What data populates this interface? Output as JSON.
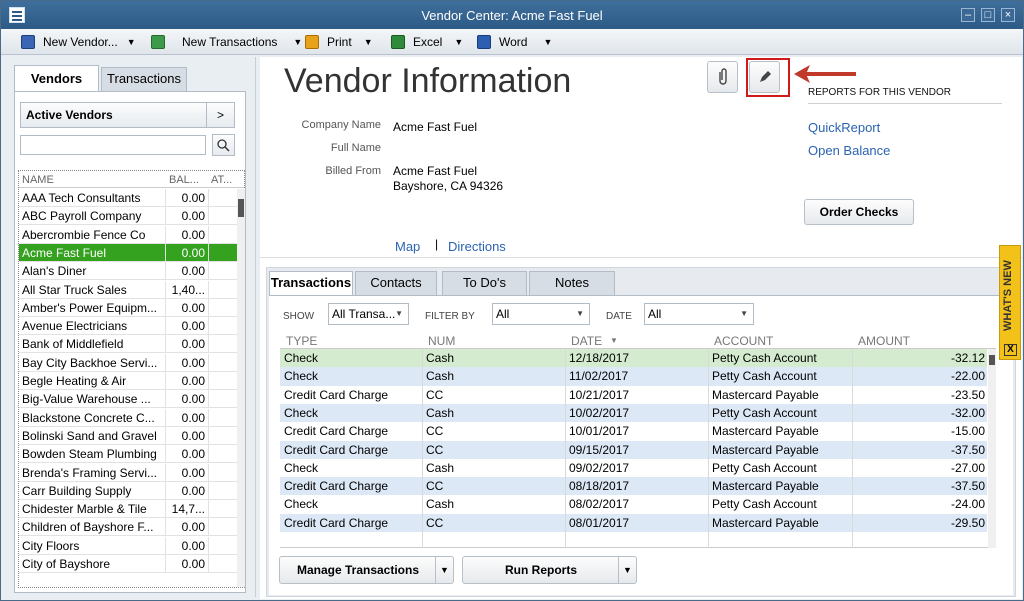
{
  "window": {
    "title": "Vendor Center: Acme Fast Fuel",
    "min": "–",
    "max": "□",
    "close": "×"
  },
  "toolbar": {
    "new_vendor": "New Vendor...",
    "new_transactions": "New Transactions",
    "print": "Print",
    "excel": "Excel",
    "word": "Word",
    "dropdown": "▼"
  },
  "left": {
    "tabs": {
      "vendors": "Vendors",
      "transactions": "Transactions"
    },
    "filter": {
      "label": "Active Vendors",
      "arrow": ">"
    },
    "columns": {
      "name": "NAME",
      "balance": "BAL...",
      "attach": "AT..."
    },
    "vendors": [
      {
        "name": "AAA Tech Consultants",
        "balance": "0.00"
      },
      {
        "name": "ABC Payroll Company",
        "balance": "0.00"
      },
      {
        "name": "Abercrombie Fence Co",
        "balance": "0.00"
      },
      {
        "name": "Acme Fast Fuel",
        "balance": "0.00",
        "selected": true
      },
      {
        "name": "Alan's Diner",
        "balance": "0.00"
      },
      {
        "name": "All Star Truck Sales",
        "balance": "1,40..."
      },
      {
        "name": "Amber's Power Equipm...",
        "balance": "0.00"
      },
      {
        "name": "Avenue Electricians",
        "balance": "0.00"
      },
      {
        "name": "Bank of Middlefield",
        "balance": "0.00"
      },
      {
        "name": "Bay City Backhoe Servi...",
        "balance": "0.00"
      },
      {
        "name": "Begle Heating & Air",
        "balance": "0.00"
      },
      {
        "name": "Big-Value Warehouse ...",
        "balance": "0.00"
      },
      {
        "name": "Blackstone Concrete C...",
        "balance": "0.00"
      },
      {
        "name": "Bolinski Sand and Gravel",
        "balance": "0.00"
      },
      {
        "name": "Bowden Steam Plumbing",
        "balance": "0.00"
      },
      {
        "name": "Brenda's Framing Servi...",
        "balance": "0.00"
      },
      {
        "name": "Carr Building Supply",
        "balance": "0.00"
      },
      {
        "name": "Chidester Marble & Tile",
        "balance": "14,7..."
      },
      {
        "name": "Children of Bayshore F...",
        "balance": "0.00"
      },
      {
        "name": "City Floors",
        "balance": "0.00"
      },
      {
        "name": "City of Bayshore",
        "balance": "0.00"
      }
    ]
  },
  "info": {
    "title": "Vendor Information",
    "labels": {
      "company_name": "Company Name",
      "full_name": "Full Name",
      "billed_from": "Billed From"
    },
    "company_name": "Acme Fast Fuel",
    "billed_from_line1": "Acme Fast Fuel",
    "billed_from_line2": "Bayshore, CA 94326",
    "map": "Map",
    "separator": "|",
    "directions": "Directions",
    "reports_header": "REPORTS FOR THIS VENDOR",
    "quick_report": "QuickReport",
    "open_balance": "Open Balance",
    "order_checks": "Order Checks"
  },
  "tx": {
    "tabs": {
      "transactions": "Transactions",
      "contacts": "Contacts",
      "todos": "To Do's",
      "notes": "Notes"
    },
    "filters": {
      "show_label": "SHOW",
      "show_value": "All Transa...",
      "filter_label": "FILTER BY",
      "filter_value": "All",
      "date_label": "DATE",
      "date_value": "All"
    },
    "columns": {
      "type": "TYPE",
      "num": "NUM",
      "date": "DATE",
      "account": "ACCOUNT",
      "amount": "AMOUNT"
    },
    "rows": [
      {
        "type": "Check",
        "num": "Cash",
        "date": "12/18/2017",
        "account": "Petty Cash Account",
        "amount": "-32.12"
      },
      {
        "type": "Check",
        "num": "Cash",
        "date": "11/02/2017",
        "account": "Petty Cash Account",
        "amount": "-22.00"
      },
      {
        "type": "Credit Card Charge",
        "num": "CC",
        "date": "10/21/2017",
        "account": "Mastercard Payable",
        "amount": "-23.50"
      },
      {
        "type": "Check",
        "num": "Cash",
        "date": "10/02/2017",
        "account": "Petty Cash Account",
        "amount": "-32.00"
      },
      {
        "type": "Credit Card Charge",
        "num": "CC",
        "date": "10/01/2017",
        "account": "Mastercard Payable",
        "amount": "-15.00"
      },
      {
        "type": "Credit Card Charge",
        "num": "CC",
        "date": "09/15/2017",
        "account": "Mastercard Payable",
        "amount": "-37.50"
      },
      {
        "type": "Check",
        "num": "Cash",
        "date": "09/02/2017",
        "account": "Petty Cash Account",
        "amount": "-27.00"
      },
      {
        "type": "Credit Card Charge",
        "num": "CC",
        "date": "08/18/2017",
        "account": "Mastercard Payable",
        "amount": "-37.50"
      },
      {
        "type": "Check",
        "num": "Cash",
        "date": "08/02/2017",
        "account": "Petty Cash Account",
        "amount": "-24.00"
      },
      {
        "type": "Credit Card Charge",
        "num": "CC",
        "date": "08/01/2017",
        "account": "Mastercard Payable",
        "amount": "-29.50"
      }
    ],
    "manage": "Manage Transactions",
    "run_reports": "Run Reports"
  },
  "whats_new": {
    "label": "WHAT'S NEW",
    "close": "X"
  },
  "colors": {
    "selected_row": "#34a11f",
    "first_tx_row": "#d4ebcf",
    "alt_row": "#dde8f6",
    "link": "#2c63b3",
    "highlight_box": "#d01a1a"
  }
}
